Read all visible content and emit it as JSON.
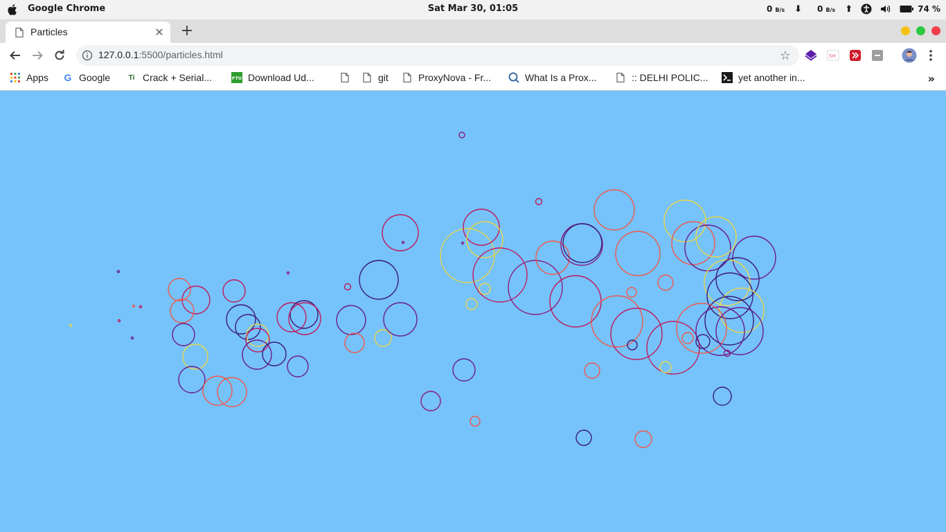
{
  "os": {
    "app_name": "Google Chrome",
    "clock": "Sat Mar 30, 01:05",
    "net_down_value": "0",
    "net_down_unit": "B/s",
    "net_up_value": "0",
    "net_up_unit": "B/s",
    "battery": "74 %"
  },
  "browser": {
    "tab_title": "Particles",
    "url_host": "127.0.0.1",
    "url_path": ":5500/particles.html",
    "bookmarks": [
      {
        "label": "Apps",
        "icon": "apps-grid-icon"
      },
      {
        "label": "Google",
        "icon": "google-icon"
      },
      {
        "label": "Crack + Serial...",
        "icon": "tipu-icon"
      },
      {
        "label": "Download Ud...",
        "icon": "ftu-icon"
      },
      {
        "label": "",
        "icon": "file-icon"
      },
      {
        "label": "git",
        "icon": "file-icon"
      },
      {
        "label": "ProxyNova - Fr...",
        "icon": "file-icon"
      },
      {
        "label": "What Is a Prox...",
        "icon": "proxy-icon"
      },
      {
        "label": ":: DELHI POLIC...",
        "icon": "file-icon"
      },
      {
        "label": "yet another in...",
        "icon": "terminal-icon"
      }
    ]
  },
  "colors": {
    "canvas_bg": "#76c2fa",
    "purple": "#6b1a8a",
    "navy": "#3a1a7a",
    "crimson": "#c2185b",
    "coral": "#f0584a",
    "yellow": "#e8d64a"
  }
}
